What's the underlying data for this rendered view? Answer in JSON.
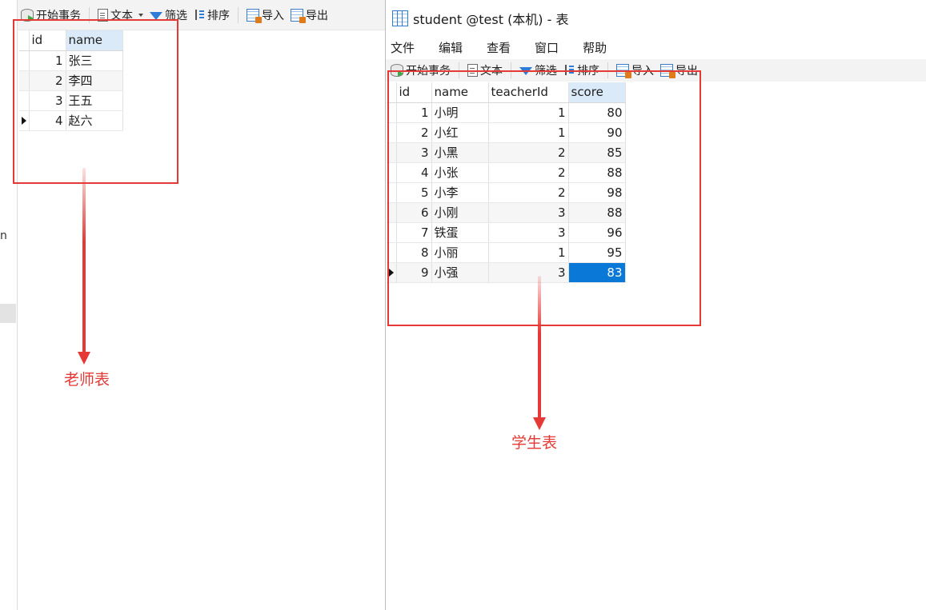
{
  "colors": {
    "accent": "#0a78d7",
    "annotation": "#e53935",
    "header_sorted": "#dbeaf8"
  },
  "left_window": {
    "gutter_text": "n",
    "toolbar": [
      {
        "icon": "database-play-icon",
        "label": "开始事务"
      },
      {
        "icon": "text-doc-icon",
        "label": "文本"
      },
      {
        "icon": "filter-icon",
        "label": "筛选"
      },
      {
        "icon": "sort-icon",
        "label": "排序"
      },
      {
        "icon": "import-icon",
        "label": "导入"
      },
      {
        "icon": "export-icon",
        "label": "导出"
      }
    ],
    "table": {
      "columns": [
        "id",
        "name"
      ],
      "rows": [
        {
          "id": "1",
          "name": "张三"
        },
        {
          "id": "2",
          "name": "李四"
        },
        {
          "id": "3",
          "name": "王五"
        },
        {
          "id": "4",
          "name": "赵六"
        }
      ]
    },
    "annotation": "老师表"
  },
  "right_window": {
    "title": "student @test (本机) - 表",
    "menu": [
      "文件",
      "编辑",
      "查看",
      "窗口",
      "帮助"
    ],
    "toolbar": [
      {
        "icon": "database-play-icon",
        "label": "开始事务"
      },
      {
        "icon": "text-doc-icon",
        "label": "文本"
      },
      {
        "icon": "filter-icon",
        "label": "筛选"
      },
      {
        "icon": "sort-icon",
        "label": "排序"
      },
      {
        "icon": "import-icon",
        "label": "导入"
      },
      {
        "icon": "export-icon",
        "label": "导出"
      }
    ],
    "table": {
      "columns": [
        "id",
        "name",
        "teacherId",
        "score"
      ],
      "rows": [
        {
          "id": "1",
          "name": "小明",
          "teacherId": "1",
          "score": "80"
        },
        {
          "id": "2",
          "name": "小红",
          "teacherId": "1",
          "score": "90"
        },
        {
          "id": "3",
          "name": "小黑",
          "teacherId": "2",
          "score": "85"
        },
        {
          "id": "4",
          "name": "小张",
          "teacherId": "2",
          "score": "88"
        },
        {
          "id": "5",
          "name": "小李",
          "teacherId": "2",
          "score": "98"
        },
        {
          "id": "6",
          "name": "小刚",
          "teacherId": "3",
          "score": "88"
        },
        {
          "id": "7",
          "name": "铁蛋",
          "teacherId": "3",
          "score": "96"
        },
        {
          "id": "8",
          "name": "小丽",
          "teacherId": "1",
          "score": "95"
        },
        {
          "id": "9",
          "name": "小强",
          "teacherId": "3",
          "score": "83"
        }
      ]
    },
    "annotation": "学生表"
  }
}
